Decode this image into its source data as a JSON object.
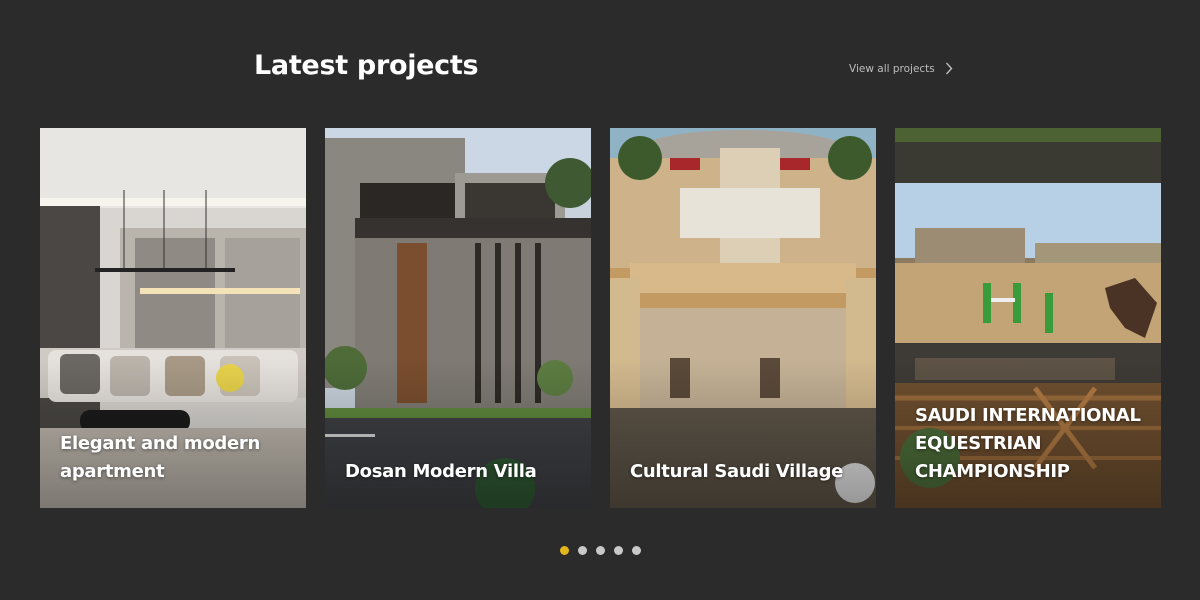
{
  "section": {
    "title": "Latest projects",
    "view_all_label": "View all projects",
    "view_all_icon": "chevron-right-icon"
  },
  "projects": [
    {
      "title": "Elegant and modern apartment"
    },
    {
      "title": "Dosan Modern Villa"
    },
    {
      "title": "Cultural Saudi Village"
    },
    {
      "title": "SAUDI INTERNATIONAL EQUESTRIAN CHAMPIONSHIP"
    }
  ],
  "pagination": {
    "count": 5,
    "active_index": 0
  },
  "colors": {
    "background": "#2b2b2b",
    "active_dot": "#e3b51c",
    "inactive_dot": "#c9c9c9"
  }
}
